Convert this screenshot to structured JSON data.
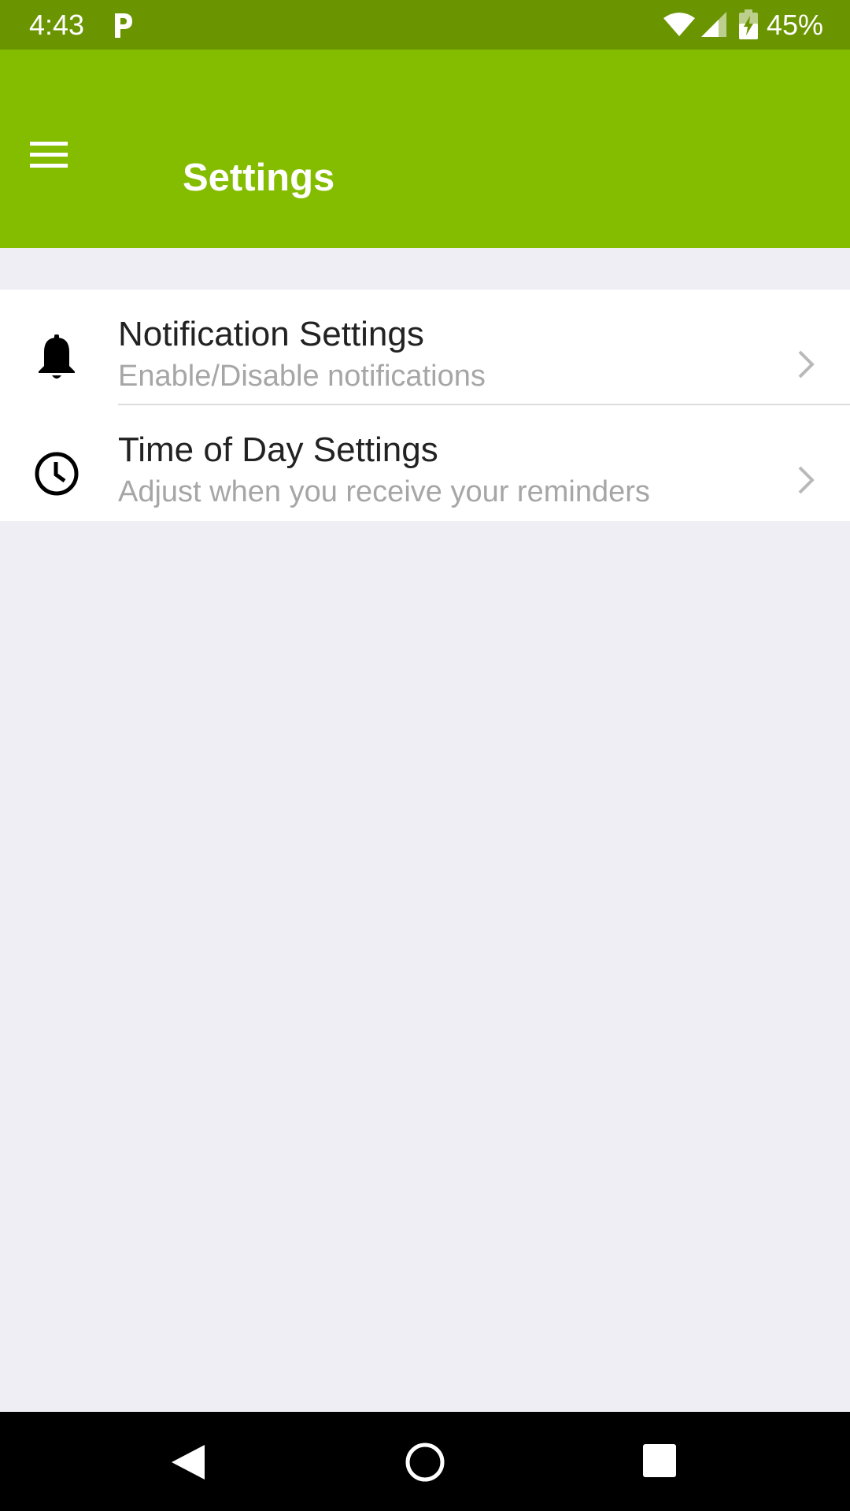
{
  "status_bar": {
    "time": "4:43",
    "battery": "45%",
    "icons": [
      "p-icon",
      "wifi-icon",
      "signal-icon",
      "battery-charging-icon"
    ]
  },
  "app_bar": {
    "title": "Settings",
    "menu_icon": "hamburger-menu-icon",
    "color": "#84bc00"
  },
  "settings": {
    "items": [
      {
        "title": "Notification Settings",
        "subtitle": "Enable/Disable notifications",
        "icon": "bell-icon"
      },
      {
        "title": "Time of Day Settings",
        "subtitle": "Adjust when you receive your reminders",
        "icon": "clock-icon"
      }
    ]
  },
  "nav_bar": {
    "icons": [
      "back-icon",
      "home-icon",
      "recents-icon"
    ]
  },
  "colors": {
    "status_bar": "#6a9500",
    "app_bar": "#84bc00",
    "background": "#efeef4",
    "subtitle": "#a6a6a6"
  }
}
